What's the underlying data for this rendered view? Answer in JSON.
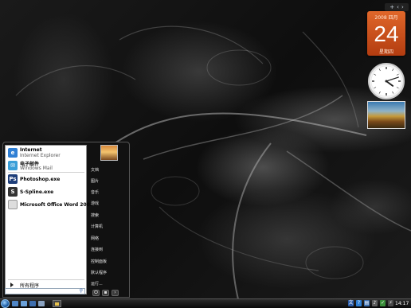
{
  "colors": {
    "calendar_bg": "#d4541c",
    "start_orb": "#1d5ea6",
    "menu_left_bg": "#ffffff",
    "menu_right_bg": "#111111"
  },
  "sidebar": {
    "header_icons": [
      "plus-icon",
      "chevron-left-icon",
      "chevron-right-icon"
    ],
    "calendar": {
      "year_month": "2008 四月",
      "day": "24",
      "weekday": "星期四"
    },
    "clock": {
      "hour": 4,
      "minute": 12
    },
    "slideshow": {
      "icon": "landscape-photo"
    }
  },
  "start_menu": {
    "pinned": [
      {
        "title": "Internet",
        "subtitle": "Internet Explorer",
        "icon": "ie-icon",
        "color": "#2f7fd4"
      },
      {
        "title": "电子邮件",
        "subtitle": "Windows Mail",
        "icon": "mail-icon",
        "color": "#3a9fd8"
      }
    ],
    "recent": [
      {
        "title": "Photoshop.exe",
        "icon": "photoshop-icon",
        "color": "#1f3f7a",
        "glyph": "Ps"
      },
      {
        "title": "S-Spline.exe",
        "icon": "sspline-icon",
        "color": "#333333",
        "glyph": "S"
      },
      {
        "title": "Microsoft Office Word 2003",
        "icon": "word-icon",
        "color": "#dddddd",
        "glyph": ""
      }
    ],
    "all_programs": "所有程序",
    "search_placeholder": "",
    "right_items": [
      "文档",
      "图片",
      "音乐",
      "游戏",
      "搜索",
      "计算机",
      "网络",
      "连接到",
      "控制面板",
      "默认程序",
      "运行..."
    ]
  },
  "taskbar": {
    "clock": "14:17",
    "tray_icons": [
      "language-icon",
      "help-icon",
      "network-icon",
      "volume-icon",
      "shield-icon",
      "power-icon"
    ]
  }
}
